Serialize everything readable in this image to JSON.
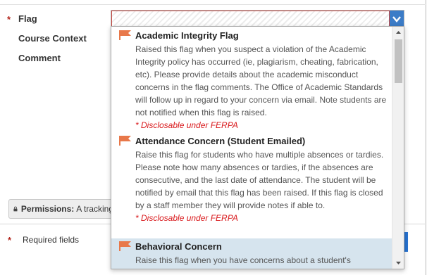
{
  "form": {
    "flag_label": "Flag",
    "course_context_label": "Course Context",
    "comment_label": "Comment",
    "required_star": "*"
  },
  "dropdown": {
    "options": [
      {
        "title": "Academic Integrity Flag",
        "description": "Raised this flag when you suspect a violation of the Academic Integrity policy has occurred (ie, plagiarism, cheating, fabrication, etc). Please provide details about the academic misconduct concerns in the flag comments. The Office of Academic Standards will follow up in regard to your concern via email. Note students are not notified when this flag is raised.",
        "note": "* Disclosable under FERPA"
      },
      {
        "title": "Attendance Concern (Student Emailed)",
        "description": "Raise this flag for students who have multiple absences or tardies. Please note how many absences or tardies, if the absences are consecutive, and the last date of attendance. The student will be notified by email that this flag has been raised. If this flag is closed by a staff member they will provide notes if able to.",
        "note": "* Disclosable under FERPA"
      },
      {
        "title": "Behavioral Concern",
        "description": "Raise this flag when you have concerns about a student's"
      }
    ]
  },
  "permissions": {
    "label": "Permissions:",
    "text": "A tracking"
  },
  "footer": {
    "required_star": "*",
    "required_text": "Required fields"
  },
  "colors": {
    "accent": "#3c7cc7",
    "flag": "#e8784a",
    "required": "#b3261e",
    "ferpa": "#d9191c",
    "selected_bg": "#d6e4ee"
  }
}
